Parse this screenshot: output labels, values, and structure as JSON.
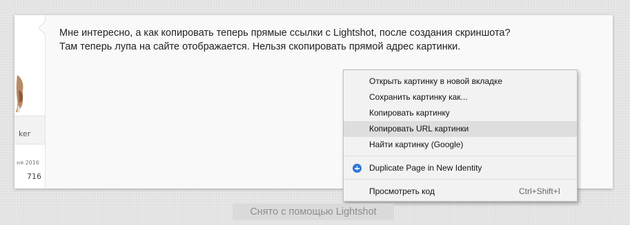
{
  "post": {
    "lines": [
      "Мне интересно, а как копировать теперь прямые ссылки с Lightshot, после создания скриншота?",
      "Там теперь лупа на сайте отображается. Нельзя скопировать прямой адрес картинки."
    ]
  },
  "user": {
    "name_fragment": "ker",
    "joined_fragment": "ня 2016",
    "post_count": "716"
  },
  "context_menu": {
    "items": [
      {
        "label": "Открыть картинку в новой вкладке"
      },
      {
        "label": "Сохранить картинку как..."
      },
      {
        "label": "Копировать картинку"
      },
      {
        "label": "Копировать URL картинки"
      },
      {
        "label": "Найти картинку (Google)"
      },
      {
        "label": "Duplicate Page in New Identity",
        "icon": "plus-circle-icon"
      },
      {
        "label": "Просмотреть код",
        "shortcut": "Ctrl+Shift+I"
      }
    ],
    "hovered_index": 3
  },
  "watermark": "Снято с помощью Lightshot",
  "colors": {
    "menu_bg": "#f2f2f2",
    "menu_hover": "#dedede",
    "icon_blue": "#2f75d6"
  }
}
